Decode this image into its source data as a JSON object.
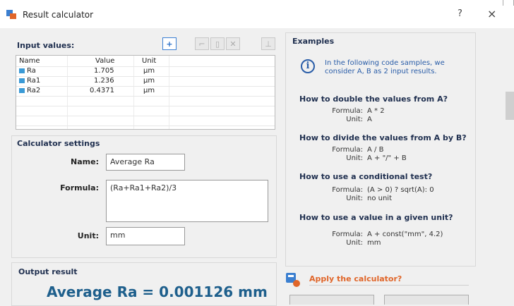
{
  "window": {
    "title": "Result calculator",
    "help_glyph": "?",
    "close_glyph": "×"
  },
  "input_values": {
    "title": "Input values:",
    "toolbar": {
      "add": "+",
      "b1": "⌐",
      "b2": "▯",
      "remove": "✕",
      "import": "⊥"
    },
    "columns": [
      "Name",
      "Value",
      "Unit"
    ],
    "rows": [
      {
        "name": "Ra",
        "value": "1.705",
        "unit": "µm"
      },
      {
        "name": "Ra1",
        "value": "1.236",
        "unit": "µm"
      },
      {
        "name": "Ra2",
        "value": "0.4371",
        "unit": "µm"
      }
    ]
  },
  "settings": {
    "title": "Calculator settings",
    "name_label": "Name:",
    "name_value": "Average Ra",
    "formula_label": "Formula:",
    "formula_value": "(Ra+Ra1+Ra2)/3",
    "unit_label": "Unit:",
    "unit_value": "mm"
  },
  "examples": {
    "title": "Examples",
    "info": "In the following code samples, we consider A, B as 2 input results.",
    "formula_key": "Formula:",
    "unit_key": "Unit:",
    "items": [
      {
        "question": "How to double the values from A?",
        "formula": "A * 2",
        "unit": "A"
      },
      {
        "question": "How to divide the values from A by B?",
        "formula": "A / B",
        "unit": "A + \"/\" + B"
      },
      {
        "question": "How to use a conditional test?",
        "formula": "(A > 0) ? sqrt(A): 0",
        "unit": "no unit"
      },
      {
        "question": "How to use a value in a given unit?",
        "formula": "A + const(\"mm\", 4.2)",
        "unit": "mm"
      }
    ]
  },
  "output": {
    "title": "Output result",
    "result": "Average Ra = 0.001126 mm"
  },
  "apply": {
    "label": "Apply the calculator?"
  },
  "colors": {
    "accent": "#2b6fc7",
    "title_blue": "#1f2f4f",
    "result_blue": "#1e5f8c",
    "apply_orange": "#e0662a"
  }
}
